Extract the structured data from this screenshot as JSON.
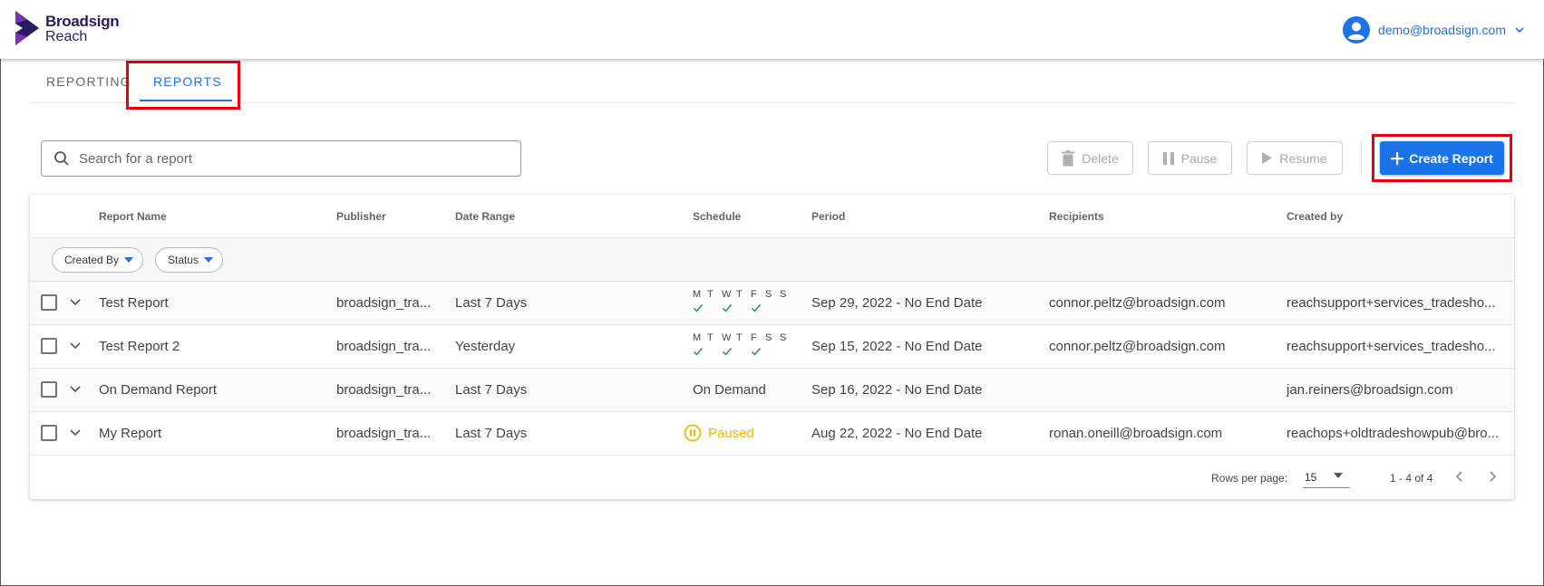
{
  "brand": {
    "name_line1": "Broadsign",
    "name_line2": "Reach",
    "colors": {
      "mark_dark": "#2a1a5e",
      "mark_accent": "#7b2fb5"
    }
  },
  "user": {
    "email": "demo@broadsign.com",
    "icon": "account-circle-icon"
  },
  "tabs": [
    {
      "label": "REPORTING",
      "active": false
    },
    {
      "label": "REPORTS",
      "active": true
    }
  ],
  "toolbar": {
    "search_placeholder": "Search for a report",
    "search_value": "",
    "delete_label": "Delete",
    "pause_label": "Pause",
    "resume_label": "Resume",
    "create_label": "Create Report"
  },
  "table": {
    "columns": [
      "Report Name",
      "Publisher",
      "Date Range",
      "Schedule",
      "Period",
      "Recipients",
      "Created by"
    ],
    "filters": [
      "Created By",
      "Status"
    ],
    "weekdays": [
      "M",
      "T",
      "W",
      "T",
      "F",
      "S",
      "S"
    ],
    "rows": [
      {
        "name": "Test Report",
        "publisher": "broadsign_tra...",
        "date_range": "Last 7 Days",
        "schedule_type": "weekly",
        "schedule_days_checked": [
          true,
          false,
          true,
          false,
          true,
          false,
          false
        ],
        "schedule_text": "",
        "period": "Sep 29, 2022 - No End Date",
        "recipients": "connor.peltz@broadsign.com",
        "created_by": "reachsupport+services_tradesho..."
      },
      {
        "name": "Test Report 2",
        "publisher": "broadsign_tra...",
        "date_range": "Yesterday",
        "schedule_type": "weekly",
        "schedule_days_checked": [
          true,
          false,
          true,
          false,
          true,
          false,
          false
        ],
        "schedule_text": "",
        "period": "Sep 15, 2022 - No End Date",
        "recipients": "connor.peltz@broadsign.com",
        "created_by": "reachsupport+services_tradesho..."
      },
      {
        "name": "On Demand Report",
        "publisher": "broadsign_tra...",
        "date_range": "Last 7 Days",
        "schedule_type": "text",
        "schedule_days_checked": [],
        "schedule_text": "On Demand",
        "period": "Sep 16, 2022 - No End Date",
        "recipients": "",
        "created_by": "jan.reiners@broadsign.com"
      },
      {
        "name": "My Report",
        "publisher": "broadsign_tra...",
        "date_range": "Last 7 Days",
        "schedule_type": "paused",
        "schedule_days_checked": [],
        "schedule_text": "Paused",
        "period": "Aug 22, 2022 - No End Date",
        "recipients": "ronan.oneill@broadsign.com",
        "created_by": "reachops+oldtradeshowpub@bro..."
      }
    ]
  },
  "pagination": {
    "rows_per_page_label": "Rows per page:",
    "rows_per_page_value": "15",
    "range_text": "1 - 4 of 4"
  },
  "colors": {
    "accent": "#1a73e8",
    "check": "#2e9e4f",
    "paused": "#f2b600",
    "highlight": "#e8000f"
  }
}
